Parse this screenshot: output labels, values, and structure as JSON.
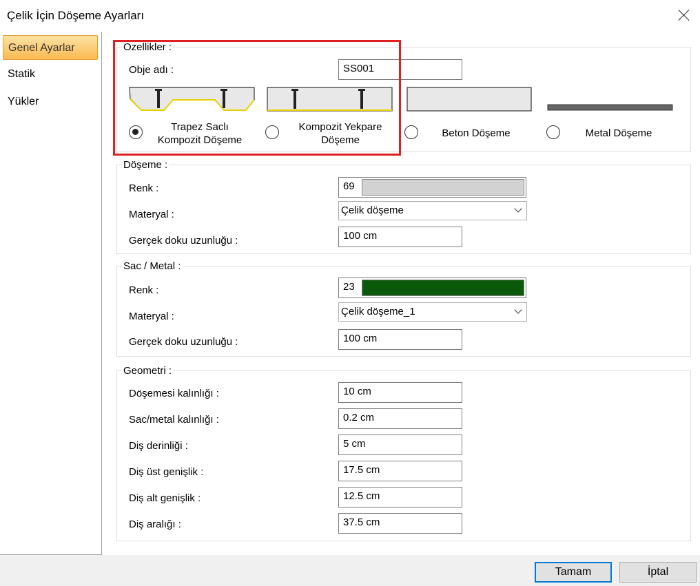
{
  "window": {
    "title": "Çelik İçin Döşeme Ayarları"
  },
  "sidebar": {
    "items": [
      {
        "label": "Genel Ayarlar",
        "active": true
      },
      {
        "label": "Statik",
        "active": false
      },
      {
        "label": "Yükler",
        "active": false
      }
    ]
  },
  "properties": {
    "title": "Ozellikler :",
    "object_name_label": "Obje adı :",
    "object_name_value": "SS001",
    "slab_types": [
      {
        "label_line1": "Trapez Saclı",
        "label_line2": "Kompozit Döşeme",
        "selected": true,
        "icon": "trapezoid-deck-icon"
      },
      {
        "label_line1": "Kompozit Yekpare",
        "label_line2": "Döşeme",
        "selected": false,
        "icon": "solid-composite-icon"
      },
      {
        "label_line1": "Beton Döşeme",
        "label_line2": "",
        "selected": false,
        "icon": "concrete-slab-icon"
      },
      {
        "label_line1": "Metal Döşeme",
        "label_line2": "",
        "selected": false,
        "icon": "metal-plate-icon"
      }
    ]
  },
  "slab": {
    "title": "Döşeme :",
    "color_label": "Renk :",
    "color_index": "69",
    "color_hex": "#d2d2d2",
    "material_label": "Materyal :",
    "material_value": "Çelik döşeme",
    "texture_label": "Gerçek doku uzunluğu :",
    "texture_value": "100 cm"
  },
  "sheet": {
    "title": "Sac / Metal :",
    "color_label": "Renk :",
    "color_index": "23",
    "color_hex": "#0b5a0b",
    "material_label": "Materyal :",
    "material_value": "Çelik döşeme_1",
    "texture_label": "Gerçek doku uzunluğu :",
    "texture_value": "100 cm"
  },
  "geometry": {
    "title": "Geometri :",
    "fields": [
      {
        "label": "Döşemesi kalınlığı :",
        "value": "10 cm"
      },
      {
        "label": "Sac/metal kalınlığı :",
        "value": "0.2 cm"
      },
      {
        "label": "Diş derinliği :",
        "value": "5 cm"
      },
      {
        "label": "Diş üst genişlik :",
        "value": "17.5 cm"
      },
      {
        "label": "Diş alt genişlik :",
        "value": "12.5 cm"
      },
      {
        "label": "Diş aralığı :",
        "value": "37.5 cm"
      }
    ]
  },
  "footer": {
    "ok_label": "Tamam",
    "cancel_label": "İptal"
  },
  "colors": {
    "highlight": "#e02020",
    "accent": "#0078d7",
    "deck_yellow": "#e8d000"
  }
}
